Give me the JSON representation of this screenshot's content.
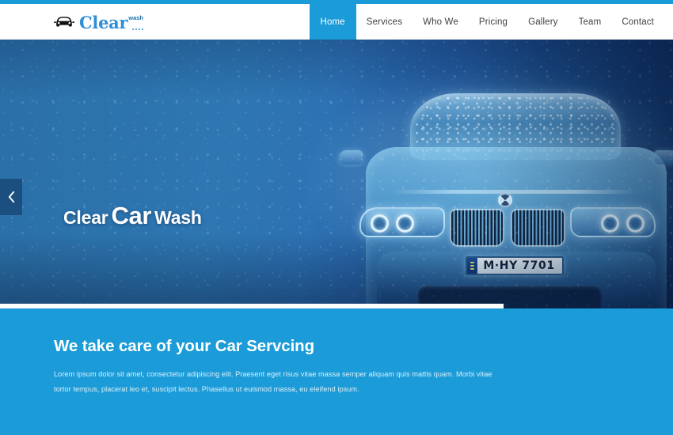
{
  "site": {
    "brand_name": "Clear",
    "brand_suffix": "wash",
    "brand_icon": "car-front-icon",
    "accent_color": "#1b9cd8",
    "promo_bg_color": "#1b9cd8",
    "hero_bg_color": "#2a72ad",
    "arrow_btn_color": "#1b4f7f"
  },
  "nav": {
    "items": [
      {
        "label": "Home",
        "active": true
      },
      {
        "label": "Services",
        "active": false
      },
      {
        "label": "Who We",
        "active": false
      },
      {
        "label": "Pricing",
        "active": false
      },
      {
        "label": "Gallery",
        "active": false
      },
      {
        "label": "Team",
        "active": false
      },
      {
        "label": "Contact",
        "active": false
      }
    ]
  },
  "hero": {
    "title_part1": "Clear",
    "title_part2": "Car",
    "title_part3": "Wash",
    "prev_arrow_icon": "chevron-left-icon",
    "image_subject": "blue-tinted BMW sedan front view covered in water droplets",
    "license_plate": "M·HY 7701"
  },
  "promo": {
    "heading": "We take care of your Car Servcing",
    "paragraph": "Lorem ipsum dolor sit amet, consectetur adipiscing elit. Praesent eget risus vitae massa semper aliquam quis mattis quam. Morbi vitae tortor tempus, placerat leo et, suscipit lectus. Phasellus ut euismod massa, eu eleifend ipsum."
  }
}
